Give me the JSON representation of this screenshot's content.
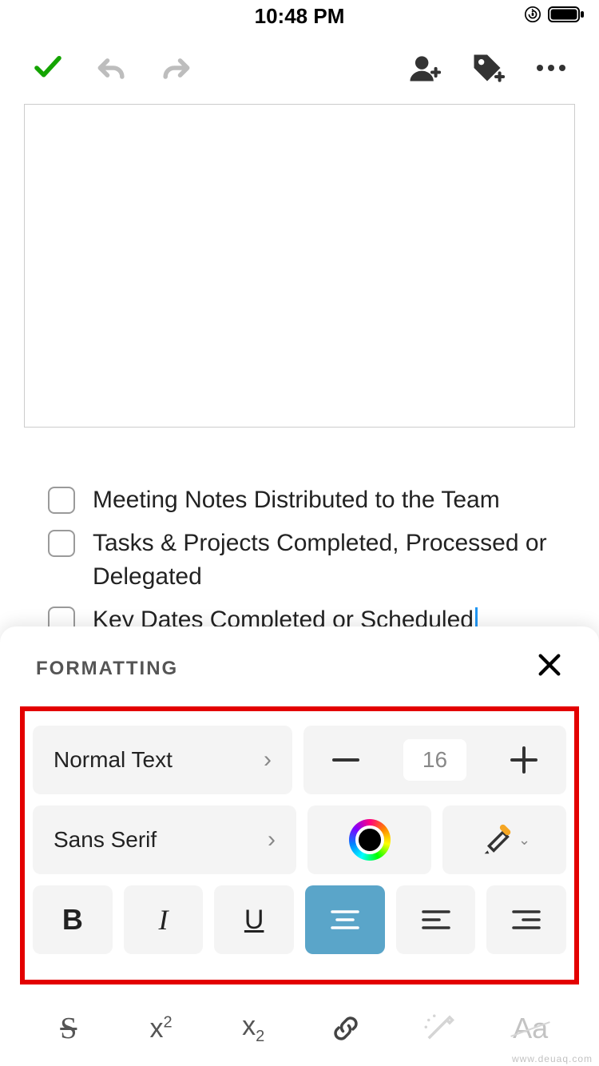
{
  "status": {
    "time": "10:48 PM"
  },
  "checklist": {
    "items": [
      {
        "text": "Meeting Notes Distributed to the Team"
      },
      {
        "text": "Tasks & Projects Completed, Processed or Delegated"
      },
      {
        "text": "Key Dates Completed or Scheduled"
      }
    ]
  },
  "formatting": {
    "title": "FORMATTING",
    "style_label": "Normal Text",
    "font_label": "Sans Serif",
    "font_size": "16"
  },
  "watermark": "www.deuaq.com"
}
